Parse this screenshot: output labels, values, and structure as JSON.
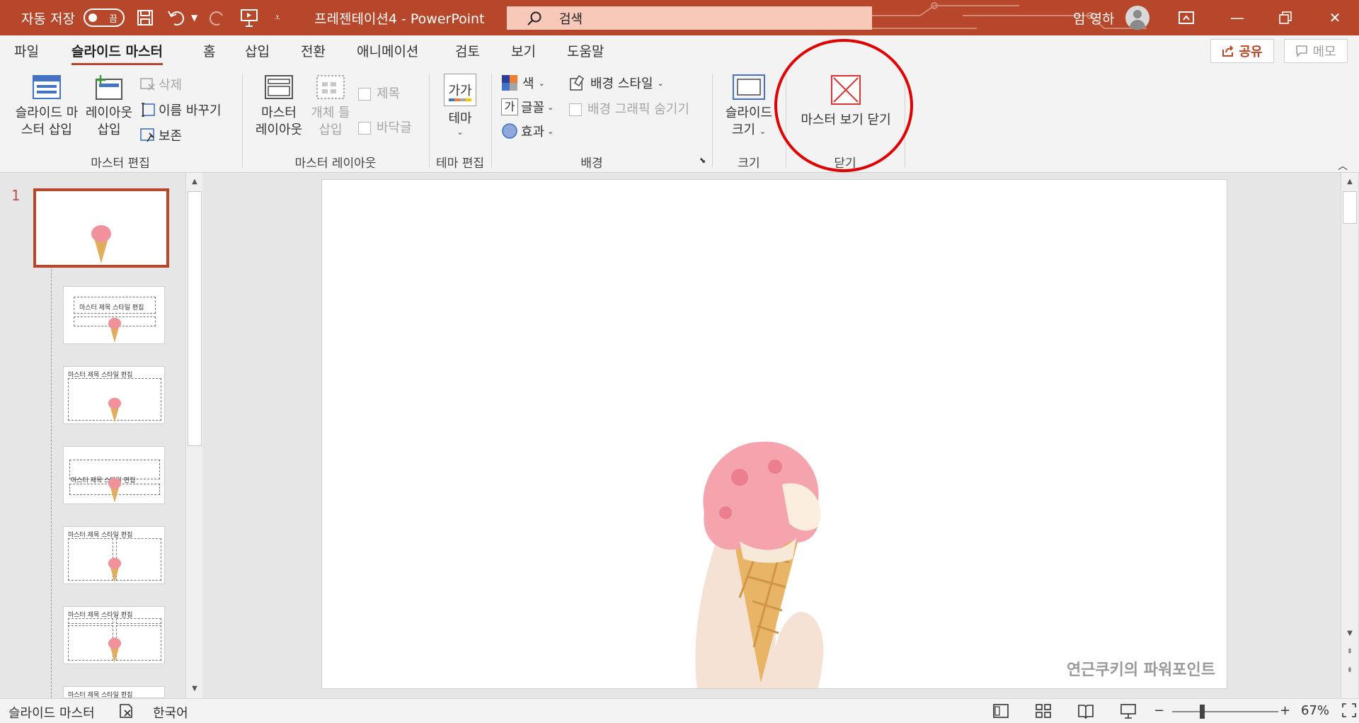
{
  "titlebar": {
    "autosave_label": "자동 저장",
    "autosave_state": "끔",
    "document_title": "프레젠테이션4  -  PowerPoint",
    "search_placeholder": "검색",
    "user_name": "임 영하"
  },
  "tabs": [
    {
      "label": "파일"
    },
    {
      "label": "슬라이드 마스터",
      "active": true
    },
    {
      "label": "홈"
    },
    {
      "label": "삽입"
    },
    {
      "label": "전환"
    },
    {
      "label": "애니메이션"
    },
    {
      "label": "검토"
    },
    {
      "label": "보기"
    },
    {
      "label": "도움말"
    }
  ],
  "share": {
    "label": "공유"
  },
  "memo": {
    "label": "메모"
  },
  "ribbon": {
    "master_edit": {
      "insert_master_l1": "슬라이드 마",
      "insert_master_l2": "스터 삽입",
      "insert_layout_l1": "레이아웃",
      "insert_layout_l2": "삽입",
      "delete": "삭제",
      "rename": "이름 바꾸기",
      "preserve": "보존",
      "group": "마스터 편집"
    },
    "master_layout": {
      "master_layout_l1": "마스터",
      "master_layout_l2": "레이아웃",
      "insert_placeholder_l1": "개체 틀",
      "insert_placeholder_l2": "삽입",
      "title_check": "제목",
      "footer_check": "바닥글",
      "group": "마스터 레이아웃"
    },
    "theme_edit": {
      "theme": "테마",
      "theme_icon_text": "가가",
      "group": "테마 편집"
    },
    "background": {
      "colors": "색",
      "fonts": "글꼴",
      "fonts_icon_text": "가",
      "effects": "효과",
      "bg_styles": "배경 스타일",
      "hide_bg_graphics": "배경 그래픽 숨기기",
      "group": "배경"
    },
    "size": {
      "slide_size_l1": "슬라이드",
      "slide_size_l2": "크기",
      "group": "크기"
    },
    "close": {
      "close_master": "마스터 보기 닫기",
      "group": "닫기"
    }
  },
  "thumbnails": {
    "selected_number": "1",
    "title_text": "마스터 제목 스타일 편집"
  },
  "slide": {
    "watermark": "연근쿠키의 파워포인트"
  },
  "statusbar": {
    "view_name": "슬라이드 마스터",
    "language": "한국어",
    "zoom": "67%"
  },
  "colors": {
    "accent": "#b7472a",
    "highlight": "#e00000"
  }
}
